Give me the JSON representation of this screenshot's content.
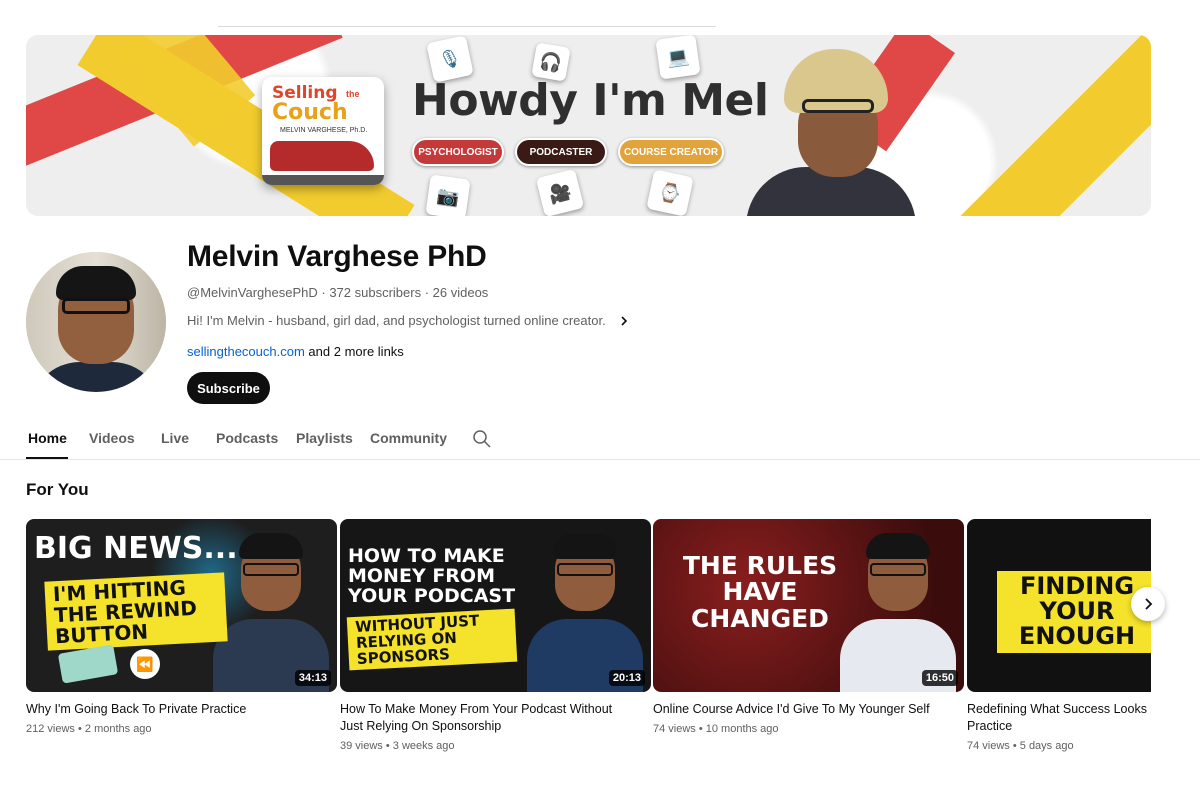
{
  "banner": {
    "book_line1": "Selling",
    "book_line1b": "the",
    "book_line2": "Couch",
    "book_author": "MELVIN VARGHESE, Ph.D.",
    "headline": "Howdy I'm Mel",
    "pills": [
      "PSYCHOLOGIST",
      "PODCASTER",
      "COURSE CREATOR"
    ]
  },
  "channel": {
    "name": "Melvin Varghese PhD",
    "handle": "@MelvinVarghesePhD",
    "subscribers": "372 subscribers",
    "videos": "26 videos",
    "meta_sep": " · ",
    "description": "Hi! I'm Melvin - husband, girl dad, and psychologist turned online creator.",
    "link": "sellingthecouch.com",
    "more_links": "and 2 more links",
    "subscribe_label": "Subscribe"
  },
  "tabs": [
    "Home",
    "Videos",
    "Live",
    "Podcasts",
    "Playlists",
    "Community"
  ],
  "section": {
    "title": "For You"
  },
  "videos": [
    {
      "thumb_headline": "BIG NEWS...",
      "thumb_box": "I'M HITTING THE REWIND BUTTON",
      "duration": "34:13",
      "title": "Why I'm Going Back To Private Practice",
      "views": "212 views",
      "age": "2 months ago"
    },
    {
      "thumb_headline": "HOW TO MAKE MONEY FROM YOUR PODCAST",
      "thumb_box": "WITHOUT JUST RELYING ON SPONSORS",
      "duration": "20:13",
      "title": "How To Make Money From Your Podcast Without Just Relying On Sponsorship",
      "views": "39 views",
      "age": "3 weeks ago"
    },
    {
      "thumb_headline": "THE RULES HAVE CHANGED",
      "thumb_box": "",
      "duration": "16:50",
      "title": "Online Course Advice I'd Give To My Younger Self",
      "views": "74 views",
      "age": "10 months ago"
    },
    {
      "thumb_headline": "",
      "thumb_box": "FINDING YOUR ENOUGH",
      "duration": "",
      "title": "Redefining What Success Looks Like In Private Practice",
      "views": "74 views",
      "age": "5 days ago"
    }
  ],
  "icons": {
    "search": "search-icon",
    "next": "chevron-right-icon",
    "desc_more": "chevron-right-icon"
  },
  "colors": {
    "subscribe_bg": "#0f0f0f",
    "link": "#065fd4",
    "banner_red": "#e04848",
    "banner_yellow": "#f2cc2e",
    "thumb_yellow": "#f5e22a"
  }
}
